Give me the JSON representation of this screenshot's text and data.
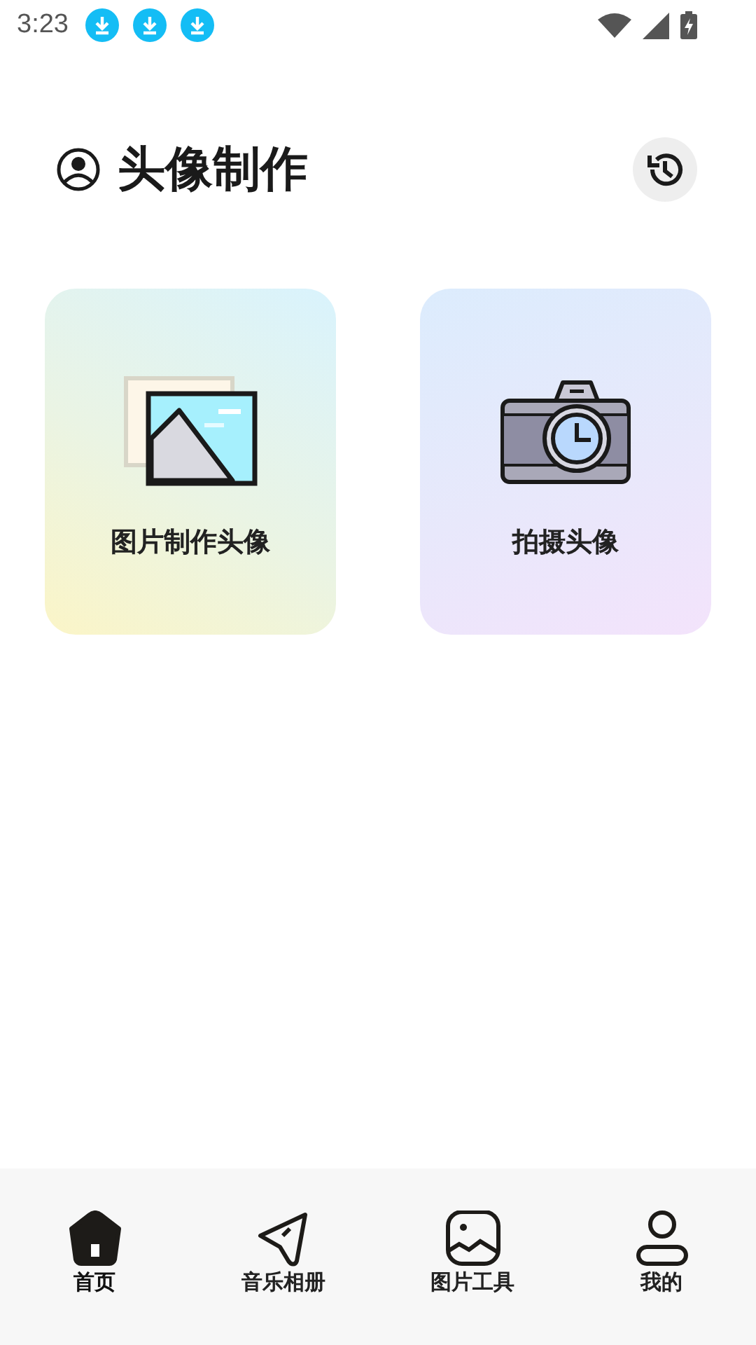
{
  "status_bar": {
    "time": "3:23",
    "notifications": [
      {
        "kind": "download"
      },
      {
        "kind": "download"
      },
      {
        "kind": "download"
      }
    ]
  },
  "header": {
    "title": "头像制作"
  },
  "cards": [
    {
      "kind": "gallery",
      "label": "图片制作头像"
    },
    {
      "kind": "camera",
      "label": "拍摄头像"
    }
  ],
  "bottom_nav": [
    {
      "kind": "home",
      "label": "首页",
      "selected": true
    },
    {
      "kind": "send",
      "label": "音乐相册",
      "selected": false
    },
    {
      "kind": "image",
      "label": "图片工具",
      "selected": false
    },
    {
      "kind": "user",
      "label": "我的",
      "selected": false
    }
  ]
}
